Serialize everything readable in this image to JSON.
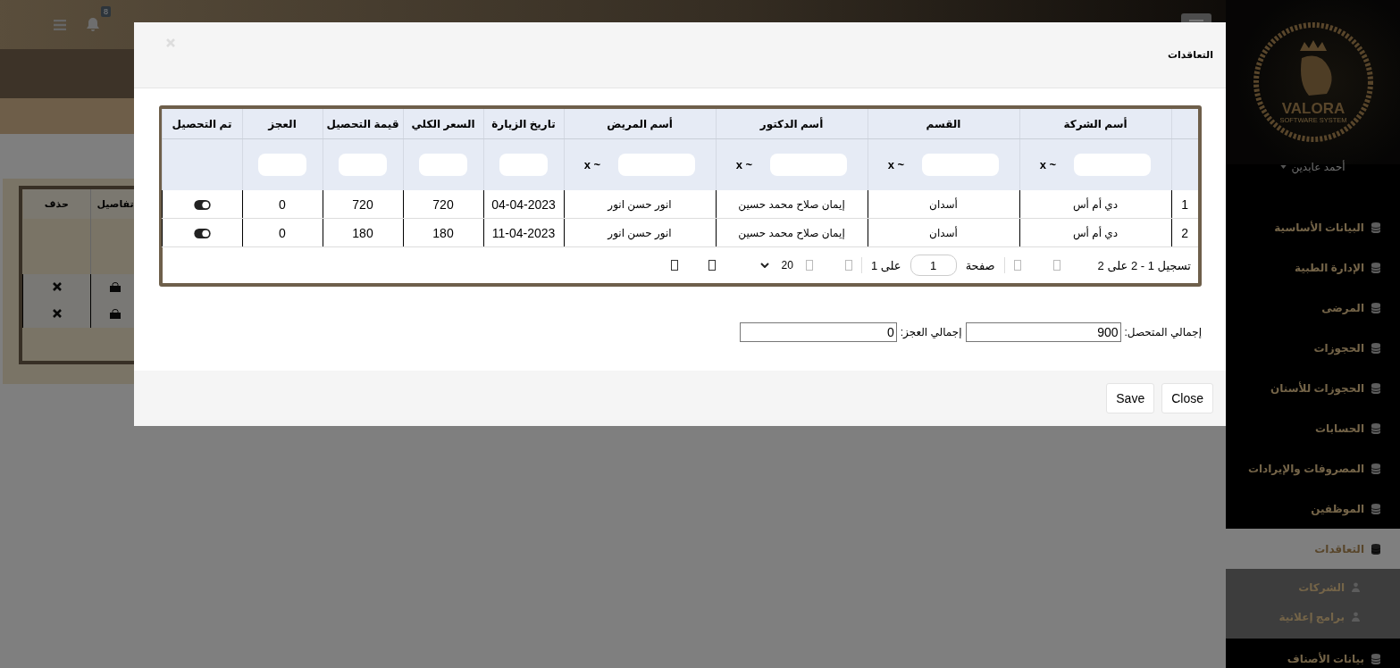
{
  "topbar": {
    "notification_count": "8"
  },
  "background_table": {
    "columns": [
      "تفاصيل",
      "حذف"
    ],
    "rows": [
      {
        "kind": "actions"
      },
      {
        "kind": "actions"
      }
    ]
  },
  "sidebar": {
    "logo": {
      "name": "VALORA",
      "tagline": "SOFTWARE SYSTEM"
    },
    "user": "أحمد عابدين",
    "items": [
      {
        "label": "البيانات الأساسية",
        "selected": false
      },
      {
        "label": "الإدارة الطبية",
        "selected": false
      },
      {
        "label": "المرضى",
        "selected": false
      },
      {
        "label": "الحجوزات",
        "selected": false
      },
      {
        "label": "الحجوزات للأسنان",
        "selected": false
      },
      {
        "label": "الحسابات",
        "selected": false
      },
      {
        "label": "المصروفات والإيرادات",
        "selected": false
      },
      {
        "label": "الموظفين",
        "selected": false
      },
      {
        "label": "التعاقدات",
        "selected": true,
        "children": [
          {
            "label": "الشركات"
          },
          {
            "label": "برامج إعلانية"
          }
        ]
      },
      {
        "label": "بيانات الأصناف",
        "selected": false
      }
    ]
  },
  "modal": {
    "title": "التعاقدات",
    "table": {
      "columns": [
        {},
        {
          "label": "أسم الشركة",
          "filter": {
            "kind": "range",
            "operator": "x ~"
          }
        },
        {
          "label": "القسم",
          "filter": {
            "kind": "range",
            "operator": "x ~"
          }
        },
        {
          "label": "أسم الدكتور",
          "filter": {
            "kind": "range",
            "operator": "x ~"
          }
        },
        {
          "label": "أسم المريض",
          "filter": {
            "kind": "range",
            "operator": "x ~"
          }
        },
        {
          "label": "تاريخ الزيارة",
          "filter": {
            "kind": "text"
          }
        },
        {
          "label": "السعر الكلي",
          "filter": {
            "kind": "text"
          }
        },
        {
          "label": "قيمة التحصيل",
          "filter": {
            "kind": "text"
          }
        },
        {
          "label": "العجز",
          "filter": {
            "kind": "text"
          }
        },
        {
          "label": "تم التحصيل"
        }
      ],
      "rows": [
        {
          "cells": [
            "1",
            "دي أم أس",
            "أسدان",
            "إيمان صلاح محمد حسين",
            "انور حسن انور",
            "04-04-2023",
            "720",
            "720",
            "0"
          ],
          "collected": true
        },
        {
          "cells": [
            "2",
            "دي أم أس",
            "أسدان",
            "إيمان صلاح محمد حسين",
            "انور حسن انور",
            "11-04-2023",
            "180",
            "180",
            "0"
          ],
          "collected": true
        }
      ],
      "pagination": {
        "records": "تسجيل 1 - 2 على 2",
        "page_label": "صفحة",
        "page": "1",
        "page_total": "على 1",
        "page_size": "20"
      }
    },
    "totals": [
      {
        "label": "إجمالي المتحصل:",
        "value": "900"
      },
      {
        "label": "إجمالي العجز:",
        "value": "0"
      }
    ],
    "buttons": [
      "Close",
      "Save"
    ]
  }
}
